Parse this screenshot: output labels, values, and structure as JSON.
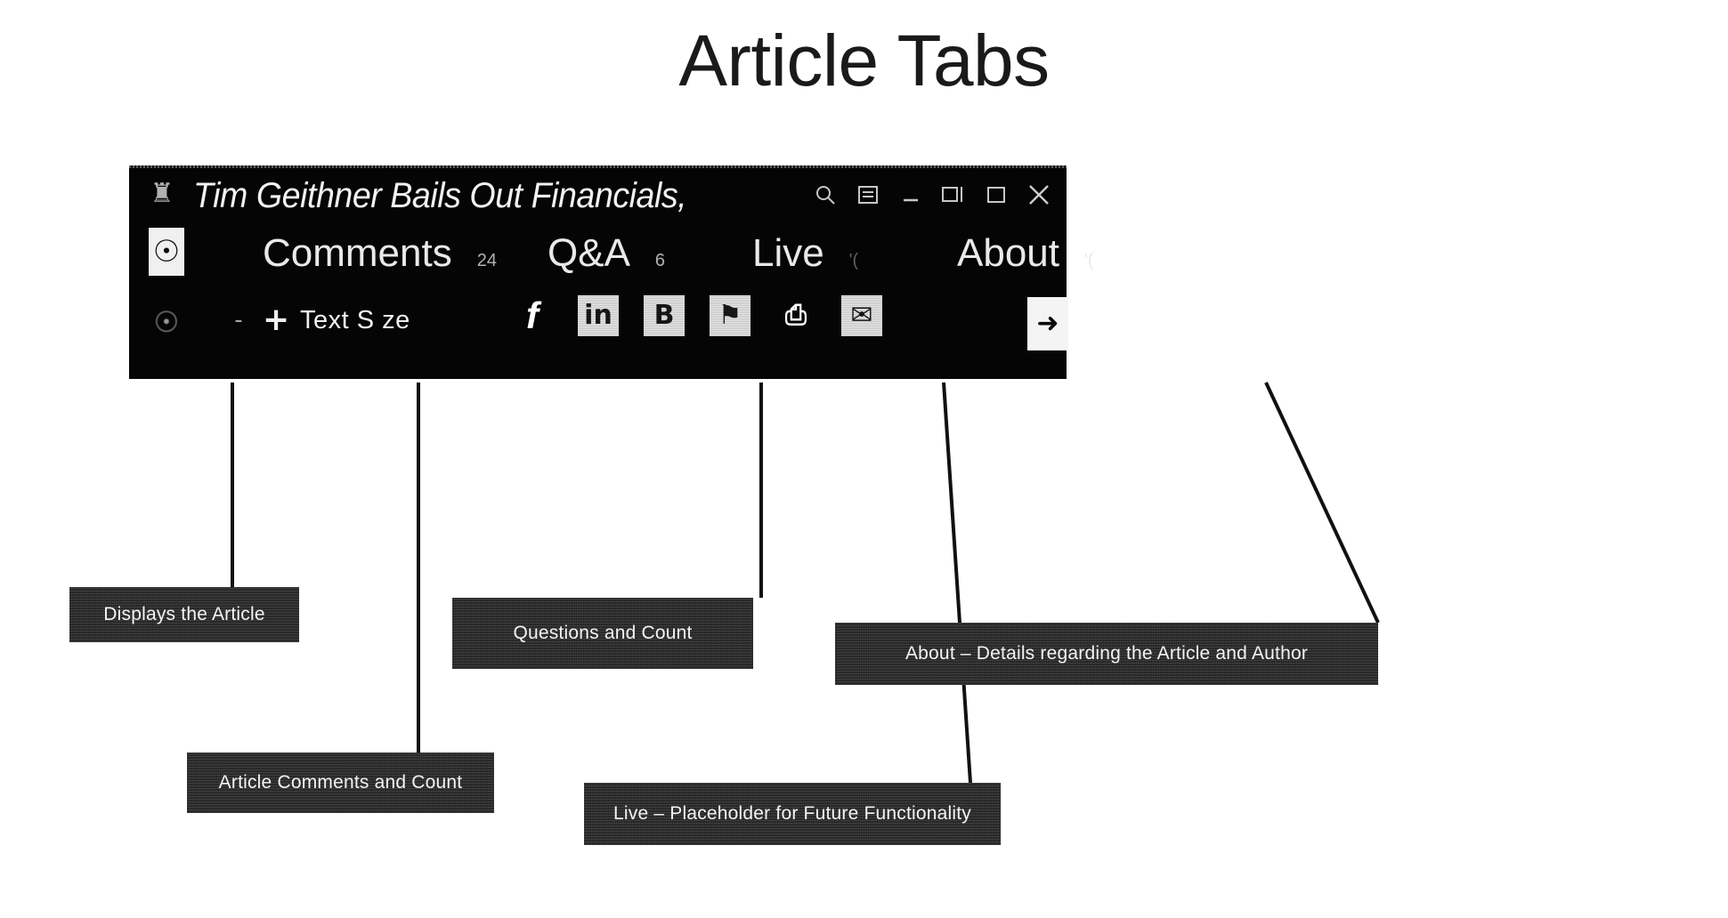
{
  "slide": {
    "title": "Article Tabs"
  },
  "app_window": {
    "titlebar": {
      "app_icon": "app-logo-icon",
      "title": "Tim Geithner Bails Out Financials,",
      "controls": [
        {
          "name": "search-icon",
          "glyph": "search"
        },
        {
          "name": "menu-icon",
          "glyph": "menu"
        },
        {
          "name": "minimize-icon",
          "glyph": "minimize"
        },
        {
          "name": "restore-icon",
          "glyph": "restore"
        },
        {
          "name": "maximize-icon",
          "glyph": "maximize"
        },
        {
          "name": "close-icon",
          "glyph": "close"
        }
      ]
    },
    "tabs": {
      "article_icon": "article-view-icon",
      "items": [
        {
          "label": "Comments",
          "count": "24"
        },
        {
          "label": "Q&A",
          "count": "6"
        },
        {
          "label": "Live",
          "count": "'("
        },
        {
          "label": "About",
          "count": "'("
        }
      ]
    },
    "toolbar": {
      "font_icon": "font-settings-icon",
      "decrease_label": "-",
      "increase_label": "+",
      "text_size_label": "Text S ze",
      "social": [
        {
          "name": "facebook-icon",
          "glyph": "f"
        },
        {
          "name": "linkedin-icon",
          "glyph": "in"
        },
        {
          "name": "blogger-icon",
          "glyph": "B"
        },
        {
          "name": "share-icon",
          "glyph": "⚑"
        },
        {
          "name": "print-icon",
          "glyph": "⎙"
        },
        {
          "name": "email-icon",
          "glyph": "✉"
        }
      ],
      "next_button": "➜"
    }
  },
  "callouts": [
    {
      "name": "callout-displays-article",
      "text": "Displays the Article"
    },
    {
      "name": "callout-article-comments",
      "text": "Article Comments and Count"
    },
    {
      "name": "callout-questions-count",
      "text": "Questions and Count"
    },
    {
      "name": "callout-live",
      "text": "Live – Placeholder for Future Functionality"
    },
    {
      "name": "callout-about",
      "text": "About – Details regarding the Article and Author"
    }
  ],
  "colors": {
    "window_bg": "#050505",
    "callout_bg": "#2b2b2b",
    "text_light": "#f2f2f2",
    "page_bg": "#ffffff"
  }
}
